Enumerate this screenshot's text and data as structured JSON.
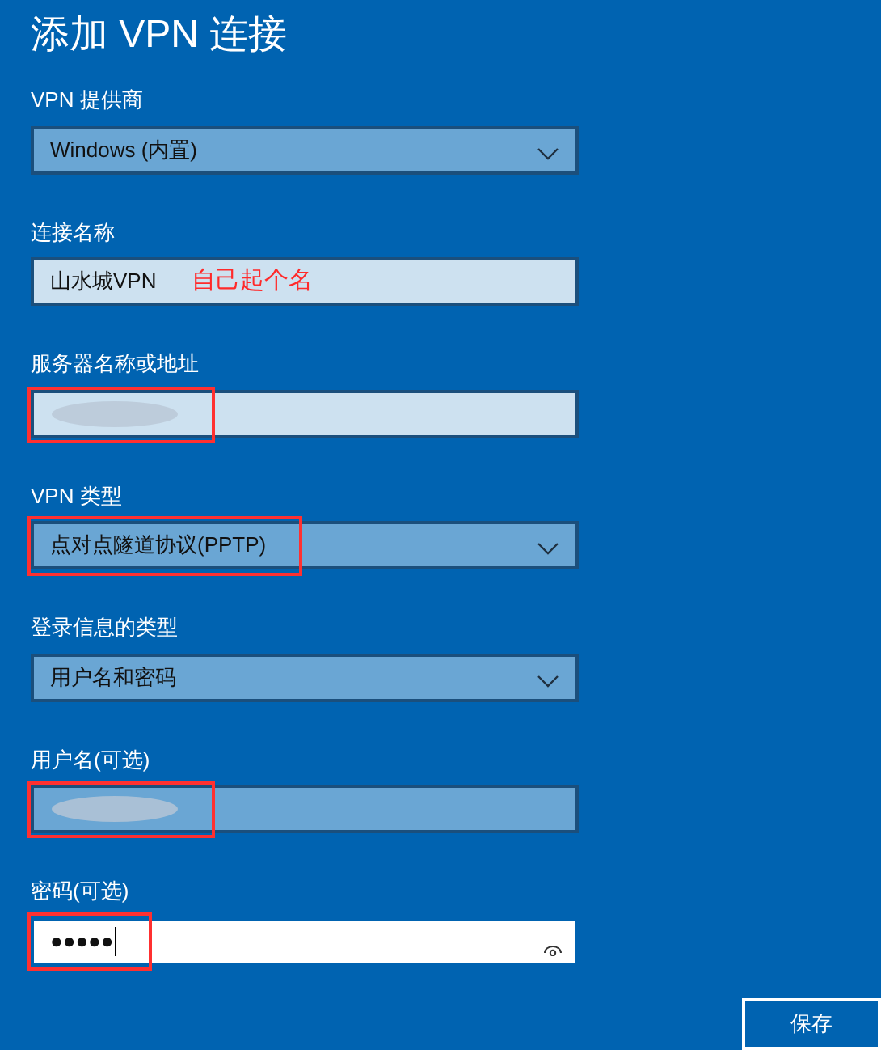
{
  "title": "添加 VPN 连接",
  "fields": [
    {
      "label": "VPN 提供商",
      "kind": "dropdown",
      "hovered": false,
      "focused": false,
      "value": "Windows (内置)",
      "highlighted": false
    },
    {
      "label": "连接名称",
      "kind": "text",
      "hovered": false,
      "focused": false,
      "value": "山水城VPN",
      "note": "自己起个名",
      "highlighted": false
    },
    {
      "label": "服务器名称或地址",
      "kind": "text",
      "hovered": false,
      "focused": false,
      "redacted": true,
      "highlighted": true
    },
    {
      "label": "VPN 类型",
      "kind": "dropdown",
      "hovered": false,
      "focused": false,
      "value": "点对点隧道协议(PPTP)",
      "highlighted": true
    },
    {
      "label": "登录信息的类型",
      "kind": "dropdown",
      "hovered": false,
      "focused": false,
      "value": "用户名和密码",
      "highlighted": false
    },
    {
      "label": "用户名(可选)",
      "kind": "text",
      "hovered": true,
      "focused": false,
      "redacted": true,
      "highlighted": true
    },
    {
      "label": "密码(可选)",
      "kind": "password",
      "hovered": false,
      "focused": true,
      "value": "●●●●●",
      "highlighted": true
    }
  ],
  "save_button": "保存"
}
